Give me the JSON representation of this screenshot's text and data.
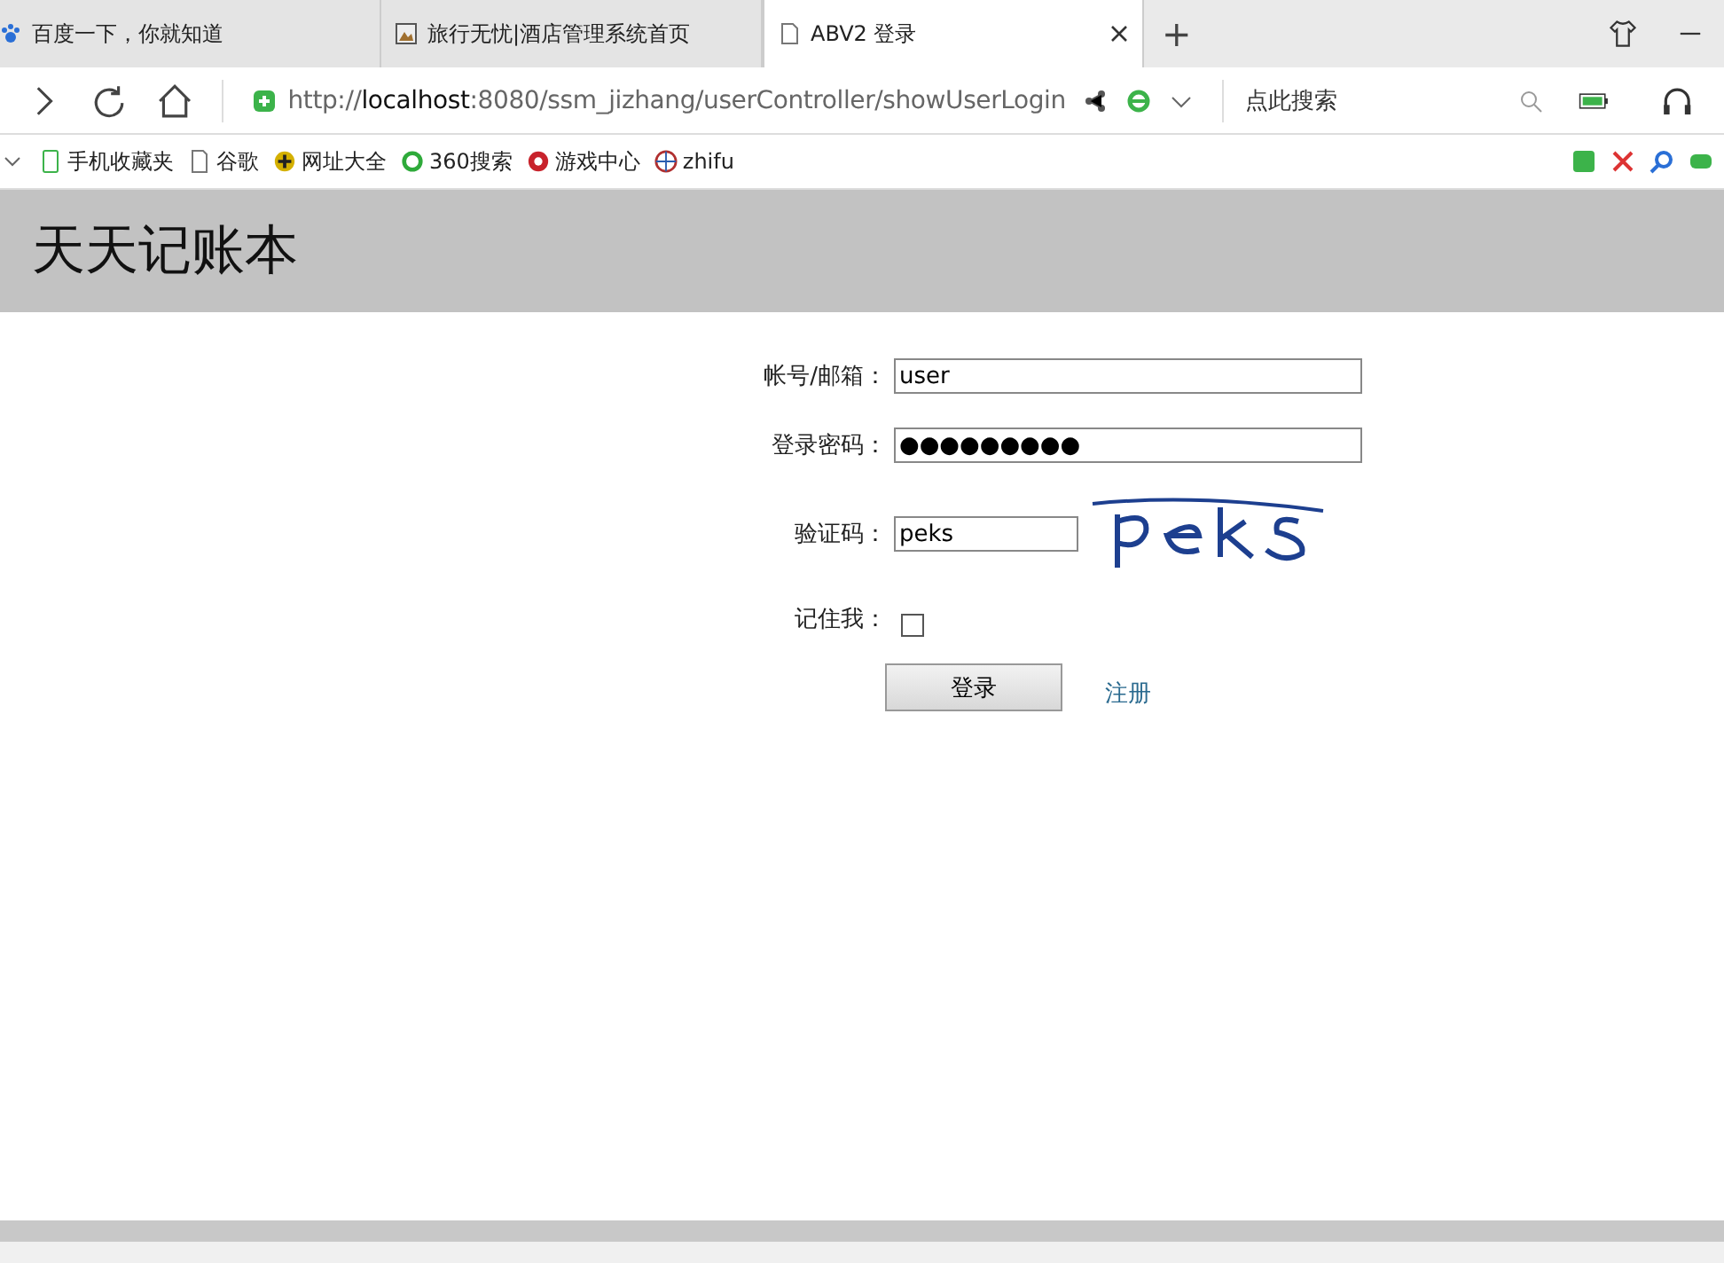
{
  "browser": {
    "tabs": [
      {
        "title": "百度一下，你就知道",
        "selected": false,
        "kind": "paw"
      },
      {
        "title": "旅行无忧|酒店管理系统首页",
        "selected": false,
        "kind": "image"
      },
      {
        "title": "ABV2 登录",
        "selected": true,
        "kind": "page"
      }
    ],
    "new_tab": "+",
    "address": {
      "host": "localhost",
      "prefix": "http://",
      "rest": ":8080/ssm_jizhang/userController/showUserLogin"
    },
    "search_placeholder": "点此搜索",
    "bookmarks": [
      {
        "label": "手机收藏夹",
        "kind": "phone"
      },
      {
        "label": "谷歌",
        "kind": "page"
      },
      {
        "label": "网址大全",
        "kind": "plus"
      },
      {
        "label": "360搜索",
        "kind": "ring"
      },
      {
        "label": "游戏中心",
        "kind": "game"
      },
      {
        "label": "zhifu",
        "kind": "globe"
      }
    ]
  },
  "header": {
    "title": "天天记账本"
  },
  "form": {
    "fields": [
      {
        "label": "帐号/邮箱：",
        "value": "user",
        "kind": "text"
      },
      {
        "label": "登录密码：",
        "value": "●●●●●●●●●",
        "kind": "password"
      },
      {
        "label": "验证码：",
        "value": "peks",
        "kind": "captcha"
      }
    ],
    "remember": {
      "label": "记住我：",
      "checked": false
    },
    "submit": "登录",
    "register": "注册"
  }
}
